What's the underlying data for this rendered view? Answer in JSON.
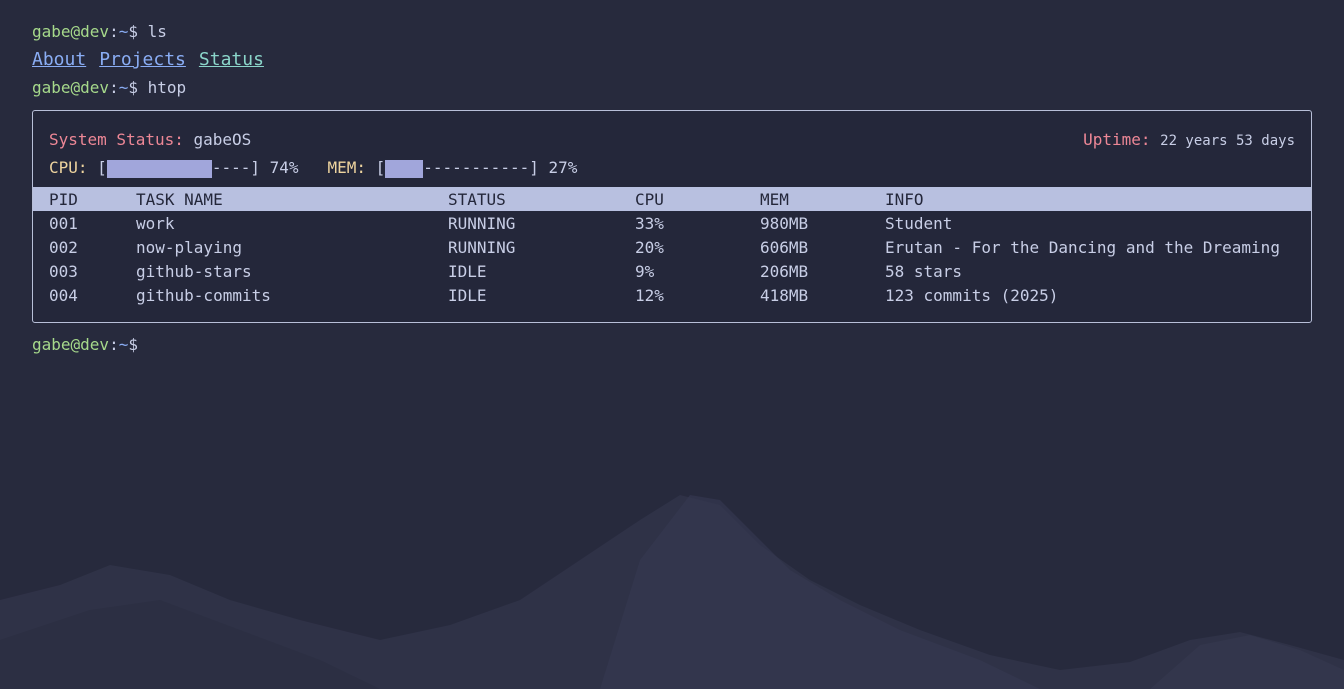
{
  "prompt": {
    "user_host": "gabe@dev",
    "colon": ":",
    "path": "~",
    "dollar": "$"
  },
  "commands": {
    "first": " ls",
    "second": " htop"
  },
  "nav": {
    "about": "About",
    "projects": "Projects",
    "status": "Status"
  },
  "htop": {
    "system_label": "System Status:",
    "system_value": "gabeOS",
    "uptime_label": "Uptime:",
    "uptime_value": "22 years 53 days",
    "cpu_label": "CPU:",
    "cpu_open": "[",
    "cpu_dashes": "----]",
    "cpu_percent": "74%",
    "cpu_fraction": 0.74,
    "mem_label": "MEM:",
    "mem_open": "[",
    "mem_dashes": "-----------]",
    "mem_percent": "27%",
    "mem_fraction": 0.27,
    "columns": [
      "PID",
      "TASK NAME",
      "STATUS",
      "CPU",
      "MEM",
      "INFO"
    ],
    "rows": [
      {
        "pid": "001",
        "name": "work",
        "status": "RUNNING",
        "cpu": "33%",
        "mem": "980MB",
        "info": "Student"
      },
      {
        "pid": "002",
        "name": "now-playing",
        "status": "RUNNING",
        "cpu": "20%",
        "mem": "606MB",
        "info": "Erutan - For the Dancing and the Dreaming"
      },
      {
        "pid": "003",
        "name": "github-stars",
        "status": "IDLE",
        "cpu": "9%",
        "mem": "206MB",
        "info": "58 stars"
      },
      {
        "pid": "004",
        "name": "github-commits",
        "status": "IDLE",
        "cpu": "12%",
        "mem": "418MB",
        "info": "123 commits (2025)"
      }
    ]
  },
  "colors": {
    "background": "#272a3d",
    "user": "#a6d98b",
    "path": "#8aadf4",
    "accent_red": "#ed8796",
    "accent_yellow": "#eed49f",
    "header_bg": "#b8c0e0"
  },
  "background_art": "mountain-silhouette"
}
